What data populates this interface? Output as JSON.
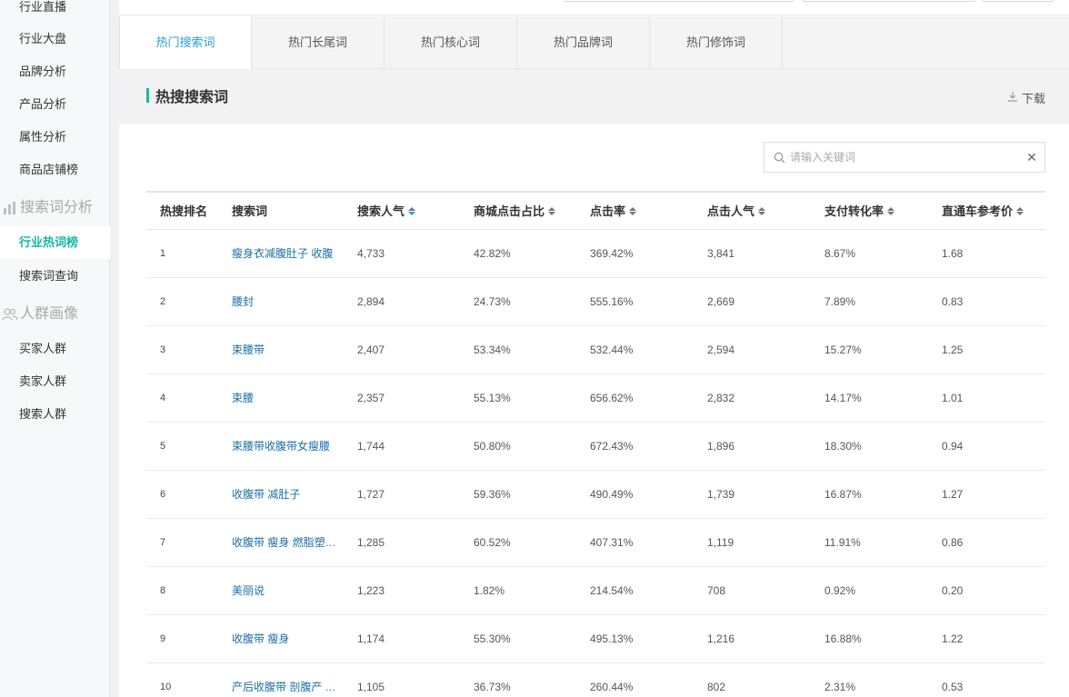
{
  "sidebar": {
    "items_top": [
      "行业直播",
      "行业大盘",
      "品牌分析",
      "产品分析",
      "属性分析",
      "商品店铺榜"
    ],
    "group_search": "搜索词分析",
    "items_search": [
      "行业热词榜",
      "搜索词查询"
    ],
    "group_crowd": "人群画像",
    "items_crowd": [
      "买家人群",
      "卖家人群",
      "搜索人群"
    ],
    "active": "行业热词榜",
    "icons": {
      "search_group": "bar-chart-icon",
      "crowd_group": "people-icon"
    }
  },
  "tabs": [
    "热门搜索词",
    "热门长尾词",
    "热门核心词",
    "热门品牌词",
    "热门修饰词"
  ],
  "active_tab": "热门搜索词",
  "section": {
    "title": "热搜搜索词",
    "download_label": "下载"
  },
  "search": {
    "placeholder": "请输入关键词",
    "value": ""
  },
  "colors": {
    "accent_teal": "#16b8a7",
    "link_blue": "#1d6fa8",
    "tab_active": "#2a9fd6"
  },
  "table": {
    "columns": [
      "热搜排名",
      "搜索词",
      "搜索人气",
      "商城点击占比",
      "点击率",
      "点击人气",
      "支付转化率",
      "直通车参考价"
    ],
    "sorted_column": "搜索人气",
    "rows": [
      {
        "rank": "1",
        "keyword": "瘦身衣减腹肚子 收腹",
        "popularity": "4,733",
        "mall_click": "42.82%",
        "ctr": "369.42%",
        "click_pop": "3,841",
        "pay_conv": "8.67%",
        "ztc_price": "1.68"
      },
      {
        "rank": "2",
        "keyword": "腰封",
        "popularity": "2,894",
        "mall_click": "24.73%",
        "ctr": "555.16%",
        "click_pop": "2,669",
        "pay_conv": "7.89%",
        "ztc_price": "0.83"
      },
      {
        "rank": "3",
        "keyword": "束腰带",
        "popularity": "2,407",
        "mall_click": "53.34%",
        "ctr": "532.44%",
        "click_pop": "2,594",
        "pay_conv": "15.27%",
        "ztc_price": "1.25"
      },
      {
        "rank": "4",
        "keyword": "束腰",
        "popularity": "2,357",
        "mall_click": "55.13%",
        "ctr": "656.62%",
        "click_pop": "2,832",
        "pay_conv": "14.17%",
        "ztc_price": "1.01"
      },
      {
        "rank": "5",
        "keyword": "束腰带收腹带女瘦腰",
        "popularity": "1,744",
        "mall_click": "50.80%",
        "ctr": "672.43%",
        "click_pop": "1,896",
        "pay_conv": "18.30%",
        "ztc_price": "0.94"
      },
      {
        "rank": "6",
        "keyword": "收腹带 减肚子",
        "popularity": "1,727",
        "mall_click": "59.36%",
        "ctr": "490.49%",
        "click_pop": "1,739",
        "pay_conv": "16.87%",
        "ztc_price": "1.27"
      },
      {
        "rank": "7",
        "keyword": "收腹带 瘦身 燃脂塑…",
        "popularity": "1,285",
        "mall_click": "60.52%",
        "ctr": "407.31%",
        "click_pop": "1,119",
        "pay_conv": "11.91%",
        "ztc_price": "0.86"
      },
      {
        "rank": "8",
        "keyword": "美丽说",
        "popularity": "1,223",
        "mall_click": "1.82%",
        "ctr": "214.54%",
        "click_pop": "708",
        "pay_conv": "0.92%",
        "ztc_price": "0.20"
      },
      {
        "rank": "9",
        "keyword": "收腹带 瘦身",
        "popularity": "1,174",
        "mall_click": "55.30%",
        "ctr": "495.13%",
        "click_pop": "1,216",
        "pay_conv": "16.88%",
        "ztc_price": "1.22"
      },
      {
        "rank": "10",
        "keyword": "产后收腹带 剖腹产 …",
        "popularity": "1,105",
        "mall_click": "36.73%",
        "ctr": "260.44%",
        "click_pop": "802",
        "pay_conv": "2.31%",
        "ztc_price": "0.53"
      }
    ]
  }
}
